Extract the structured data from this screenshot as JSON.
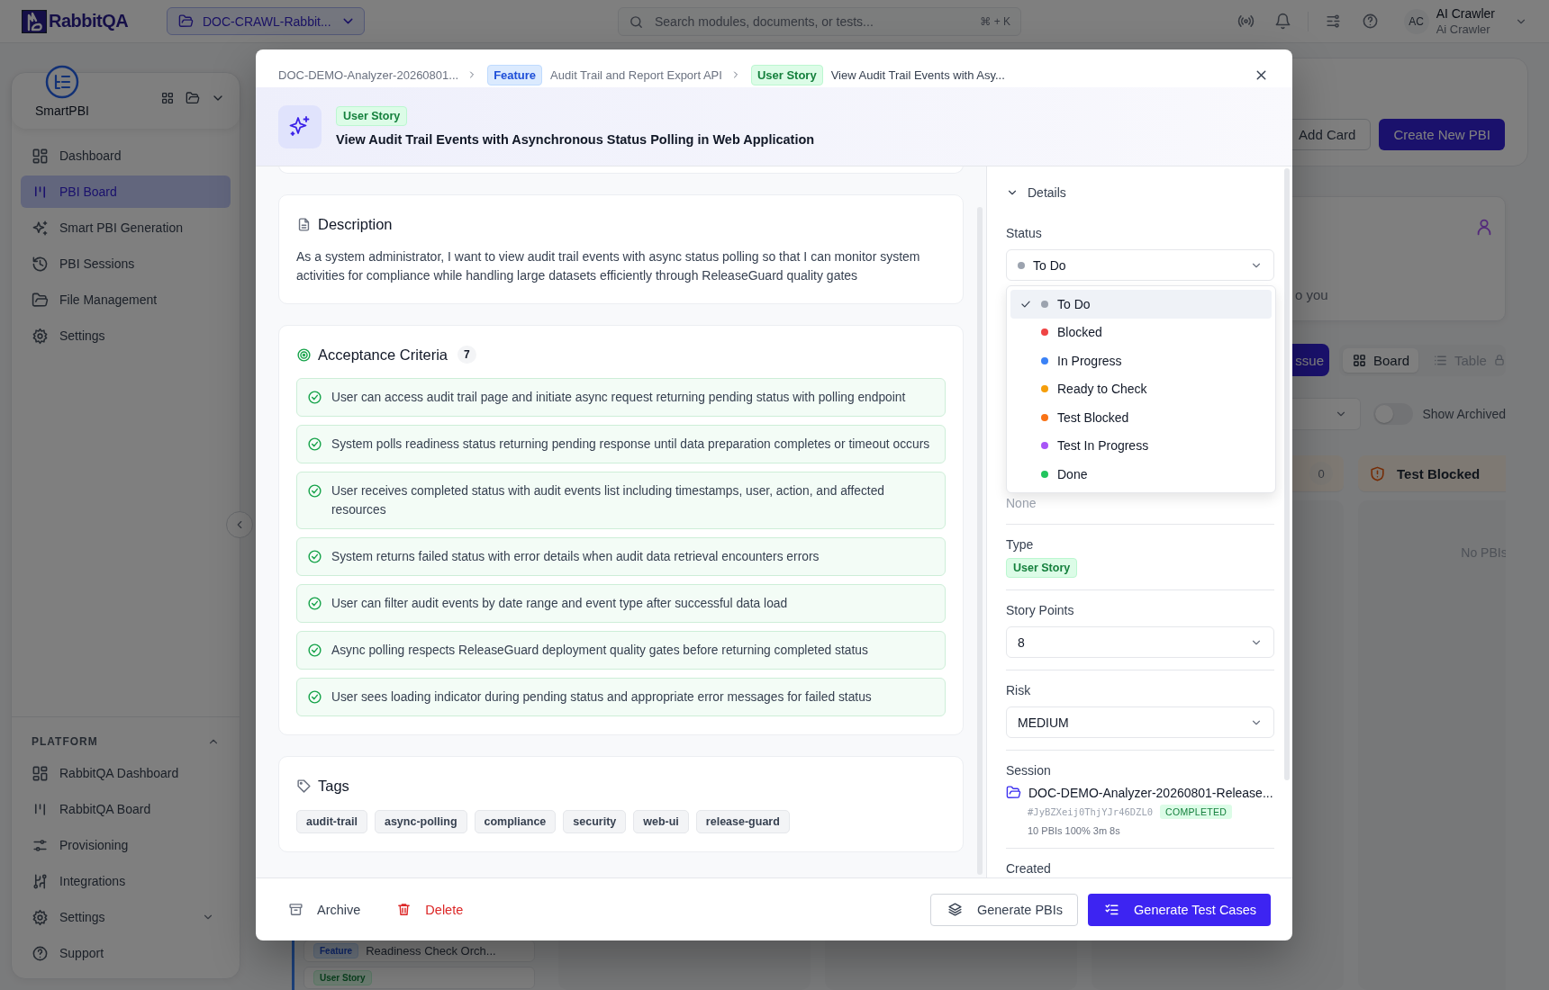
{
  "topbar": {
    "logo": "RabbitQA",
    "project": "DOC-CRAWL-Rabbit...",
    "search": {
      "placeholder": "Search modules, documents, or tests...",
      "shortcut": "⌘ + K"
    },
    "user": {
      "initials": "AC",
      "name": "AI Crawler",
      "subtitle": "Ai Crawler"
    }
  },
  "sidebar": {
    "app": "SmartPBI",
    "items": [
      {
        "label": "Dashboard",
        "kind": "dashboard",
        "selected": false
      },
      {
        "label": "PBI Board",
        "kind": "board",
        "selected": true
      },
      {
        "label": "Smart PBI Generation",
        "kind": "sparkles",
        "selected": false
      },
      {
        "label": "PBI Sessions",
        "kind": "history",
        "selected": false
      },
      {
        "label": "File Management",
        "kind": "folder",
        "selected": false
      },
      {
        "label": "Settings",
        "kind": "gear",
        "selected": false
      }
    ],
    "platform": {
      "title": "PLATFORM",
      "expanded": true,
      "items": [
        {
          "label": "RabbitQA Dashboard",
          "kind": "dashboard",
          "submenu": false
        },
        {
          "label": "RabbitQA Board",
          "kind": "board",
          "submenu": false
        },
        {
          "label": "Provisioning",
          "kind": "sliders",
          "submenu": false
        },
        {
          "label": "Integrations",
          "kind": "route",
          "submenu": false
        },
        {
          "label": "Settings",
          "kind": "gear",
          "submenu": true
        },
        {
          "label": "Support",
          "kind": "help",
          "submenu": false
        }
      ]
    }
  },
  "board": {
    "add_card": "Add Card",
    "create": "Create New PBI",
    "assigned_text": "o you",
    "issue_button": "ssue",
    "views": [
      {
        "label": "Board",
        "selected": true,
        "locked": false
      },
      {
        "label": "Table",
        "selected": false,
        "locked": true
      }
    ],
    "show_archived": {
      "label": "Show Archived",
      "on": false
    },
    "columns": [
      {
        "cards": [
          {
            "type": "Feature",
            "kind": "feature",
            "title": "Readiness Check Orch..."
          },
          {
            "type": "User Story",
            "kind": "story"
          }
        ]
      },
      {},
      {},
      {
        "count": "0"
      },
      {
        "title": "Test Blocked",
        "empty_text": "No PBIs"
      }
    ]
  },
  "modal": {
    "breadcrumb": [
      {
        "text": "DOC-DEMO-Analyzer-20260801..."
      },
      {
        "badge": "Feature",
        "kind": "feature",
        "text": "Audit Trail and Report Export API"
      },
      {
        "badge": "User Story",
        "kind": "story",
        "text": "View Audit Trail Events with Asy..."
      }
    ],
    "type_badge": "User Story",
    "title": "View Audit Trail Events with Asynchronous Status Polling in Web Application",
    "description": {
      "heading": "Description",
      "text": "As a system administrator, I want to view audit trail events with async status polling so that I can monitor system activities for compliance while handling large datasets efficiently through ReleaseGuard quality gates"
    },
    "acceptance": {
      "heading": "Acceptance Criteria",
      "count": "7",
      "items": [
        "User can access audit trail page and initiate async request returning pending status with polling endpoint",
        "System polls readiness status returning pending response until data preparation completes or timeout occurs",
        "User receives completed status with audit events list including timestamps, user, action, and affected resources",
        "System returns failed status with error details when audit data retrieval encounters errors",
        "User can filter audit events by date range and event type after successful data load",
        "Async polling respects ReleaseGuard deployment quality gates before returning completed status",
        "User sees loading indicator during pending status and appropriate error messages for failed status"
      ]
    },
    "tags": {
      "heading": "Tags",
      "items": [
        "audit-trail",
        "async-polling",
        "compliance",
        "security",
        "web-ui",
        "release-guard"
      ]
    },
    "details": {
      "heading": "Details",
      "expanded": true,
      "status": {
        "label": "Status",
        "value": "To Do",
        "color": "#9ca3af",
        "open": true,
        "options": [
          {
            "label": "To Do",
            "color": "#9ca3af",
            "selected": true
          },
          {
            "label": "Blocked",
            "color": "#ef4444",
            "selected": false
          },
          {
            "label": "In Progress",
            "color": "#3b82f6",
            "selected": false
          },
          {
            "label": "Ready to Check",
            "color": "#f59e0b",
            "selected": false
          },
          {
            "label": "Test Blocked",
            "color": "#f97316",
            "selected": false
          },
          {
            "label": "Test In Progress",
            "color": "#a855f7",
            "selected": false
          },
          {
            "label": "Done",
            "color": "#22c55e",
            "selected": false
          }
        ]
      },
      "covered_value": "None",
      "type": {
        "label": "Type",
        "value": "User Story"
      },
      "story_points": {
        "label": "Story Points",
        "value": "8"
      },
      "risk": {
        "label": "Risk",
        "value": "MEDIUM"
      },
      "session": {
        "label": "Session",
        "name": "DOC-DEMO-Analyzer-20260801-Release...",
        "id": "#JyBZXeij0ThjYJr46DZL0",
        "status": "COMPLETED",
        "stats": "10 PBIs 100% 3m 8s"
      },
      "created": {
        "label": "Created"
      }
    },
    "footer": {
      "archive": "Archive",
      "delete": "Delete",
      "generate_pbis": "Generate PBIs",
      "generate_tests": "Generate Test Cases"
    }
  }
}
